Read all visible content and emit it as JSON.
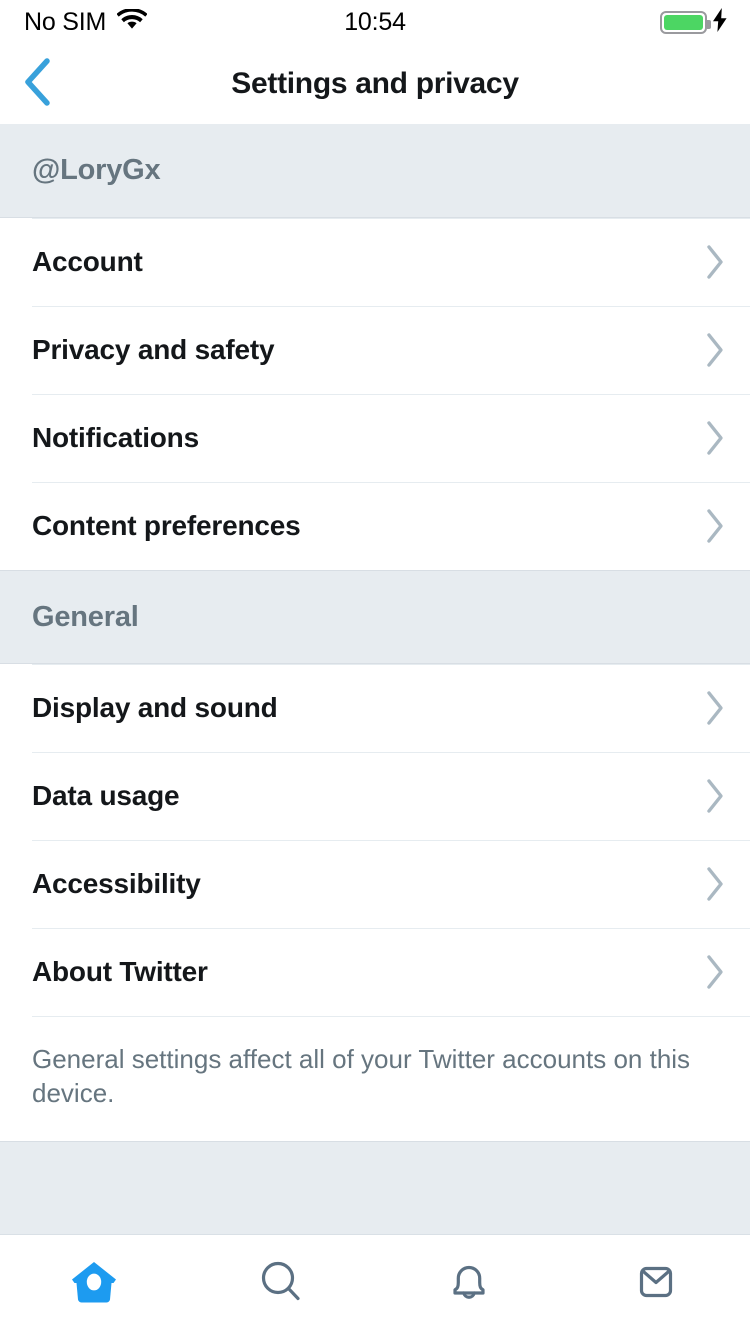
{
  "status_bar": {
    "carrier": "No SIM",
    "wifi_icon": "wifi-icon",
    "time": "10:54",
    "battery_icon": "battery-icon",
    "battery_fill_color": "#4CD663",
    "charging_icon": "lightning-bolt-icon"
  },
  "navbar": {
    "back_icon": "chevron-left-icon",
    "back_color": "#38a1db",
    "title": "Settings and privacy"
  },
  "sections": [
    {
      "header": "@LoryGx",
      "rows": [
        {
          "label": "Account",
          "chevron": "chevron-right-icon"
        },
        {
          "label": "Privacy and safety",
          "chevron": "chevron-right-icon"
        },
        {
          "label": "Notifications",
          "chevron": "chevron-right-icon"
        },
        {
          "label": "Content preferences",
          "chevron": "chevron-right-icon"
        }
      ]
    },
    {
      "header": "General",
      "rows": [
        {
          "label": "Display and sound",
          "chevron": "chevron-right-icon"
        },
        {
          "label": "Data usage",
          "chevron": "chevron-right-icon"
        },
        {
          "label": "Accessibility",
          "chevron": "chevron-right-icon"
        },
        {
          "label": "About Twitter",
          "chevron": "chevron-right-icon"
        }
      ],
      "footnote": "General settings affect all of your Twitter accounts on this device."
    }
  ],
  "tabbar": {
    "items": [
      {
        "name": "home-icon",
        "active": true
      },
      {
        "name": "search-icon",
        "active": false
      },
      {
        "name": "bell-icon",
        "active": false
      },
      {
        "name": "envelope-icon",
        "active": false
      }
    ],
    "active_color": "#1d9bf0",
    "inactive_color": "#5b7083"
  },
  "colors": {
    "band": "#E7ECF0",
    "separator": "#E6ECF0",
    "text": "#14171A",
    "muted": "#66757F",
    "accent": "#1DA1F2"
  }
}
